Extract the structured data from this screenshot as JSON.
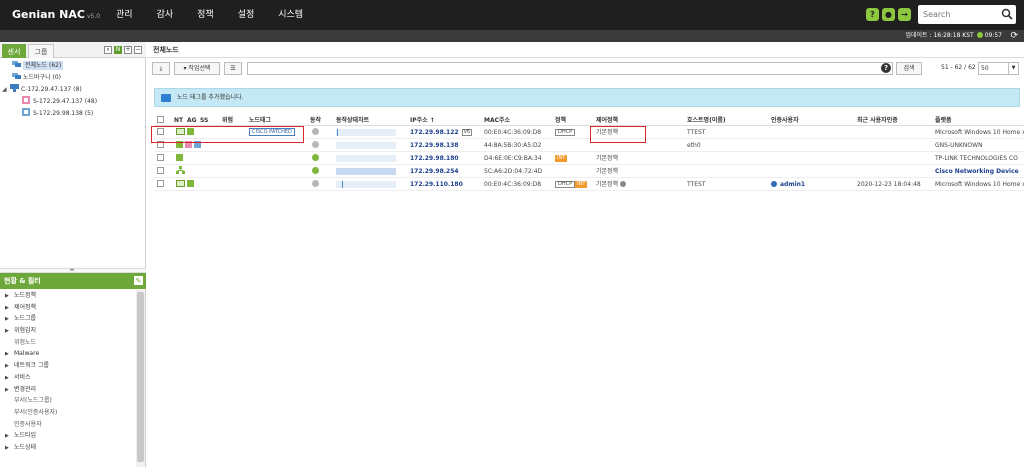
{
  "app": {
    "brand": "Genian NAC",
    "version": "v5.0"
  },
  "nav": [
    "관리",
    "감사",
    "정책",
    "설정",
    "시스템"
  ],
  "top_icons": [
    "help-icon",
    "user-icon",
    "logout-icon"
  ],
  "search": {
    "placeholder": "Search"
  },
  "subbar": {
    "update_label": "업데이트 :",
    "update_time": "16:28:18 KST",
    "clock": "09:57"
  },
  "sidebar": {
    "tabs": [
      "센서",
      "그룹"
    ],
    "tree": [
      {
        "label": "전체노드 (62)",
        "selected": true
      },
      {
        "label": "노드바구니 (0)"
      },
      {
        "label": "C-172.29.47.137 (8)"
      },
      {
        "label": "S-172.29.47.137 (48)"
      },
      {
        "label": "S-172.29.98.138 (5)"
      }
    ],
    "panel_title": "현황 & 필터",
    "panel_items": [
      {
        "label": "노드정책",
        "caret": true
      },
      {
        "label": "제어정책",
        "caret": true
      },
      {
        "label": "노드그룹",
        "caret": true
      },
      {
        "label": "위험감지",
        "caret": true
      },
      {
        "label": "위험노드",
        "caret": false
      },
      {
        "label": "Malware",
        "caret": true
      },
      {
        "label": "네트워크 그룹",
        "caret": true
      },
      {
        "label": "서비스",
        "caret": true
      },
      {
        "label": "변경관리",
        "caret": true
      },
      {
        "label": "부서(노드그룹)",
        "caret": false
      },
      {
        "label": "부서(인증사용자)",
        "caret": false
      },
      {
        "label": "인증사용자",
        "caret": false
      },
      {
        "label": "노드타입",
        "caret": true
      },
      {
        "label": "노드상태",
        "caret": true
      }
    ]
  },
  "content": {
    "title": "전체노드",
    "toolbar": {
      "action_label": "▾ 작업선택",
      "search_button": "검색",
      "page_info": "51 - 62 / 62",
      "page_size": "50"
    },
    "alert": "노드 태그를 추가했습니다.",
    "columns": [
      "NT",
      "AG",
      "SS",
      "위험",
      "노드태그",
      "동작",
      "동작상태차트",
      "IP주소 ↑",
      "MAC주소",
      "정책",
      "제어정책",
      "호스트명(이름)",
      "인증사용자",
      "최근 사용자인증",
      "플랫폼"
    ],
    "rows": [
      {
        "tag": "CISCO PATCHED",
        "status": "gray",
        "ip": "172.29.98.122",
        "v6": "V6",
        "mac": "00:E0:4C:36:09:D8",
        "policy_badge": "DHCP",
        "control": "기본정책",
        "host": "TTEST",
        "user": "",
        "last_auth": "",
        "platform": "Microsoft Windows 10 Home x6"
      },
      {
        "tag": "",
        "status": "gray",
        "ip": "172.29.98.138",
        "v6": "",
        "mac": "44:8A:5B:30:A5:D2",
        "policy_badge": "",
        "control": "",
        "host": "eth0",
        "user": "",
        "last_auth": "",
        "platform": "GNS-UNKNOWN"
      },
      {
        "tag": "",
        "status": "green",
        "ip": "172.29.98.180",
        "v6": "",
        "mac": "D4:6E:0E:C9:BA:34",
        "policy_badge": "INT",
        "control": "기본정책",
        "host": "",
        "user": "",
        "last_auth": "",
        "platform": "TP-LINK TECHNOLOGIES CO"
      },
      {
        "tag": "",
        "status": "green",
        "ip": "172.29.98.254",
        "v6": "",
        "mac": "5C:A6:2D:04:72:4D",
        "policy_badge": "",
        "control": "기본정책",
        "host": "",
        "user": "",
        "last_auth": "",
        "platform": "Cisco Networking Device"
      },
      {
        "tag": "",
        "status": "gray",
        "ip": "172.29.110.180",
        "v6": "",
        "mac": "00:E0:4C:36:09:D8",
        "policy_badge": "DHCP",
        "policy_badge2": "INT",
        "control": "기본정책",
        "host": "TTEST",
        "user": "admin1",
        "last_auth": "2020-12-23 18:04:48",
        "platform": "Microsoft Windows 10 Home x6"
      }
    ]
  },
  "colors": {
    "brand_green": "#8dc63f",
    "panel_green": "#6fa83a",
    "highlight_red": "#d9262c",
    "link_blue": "#1c3f8f"
  }
}
